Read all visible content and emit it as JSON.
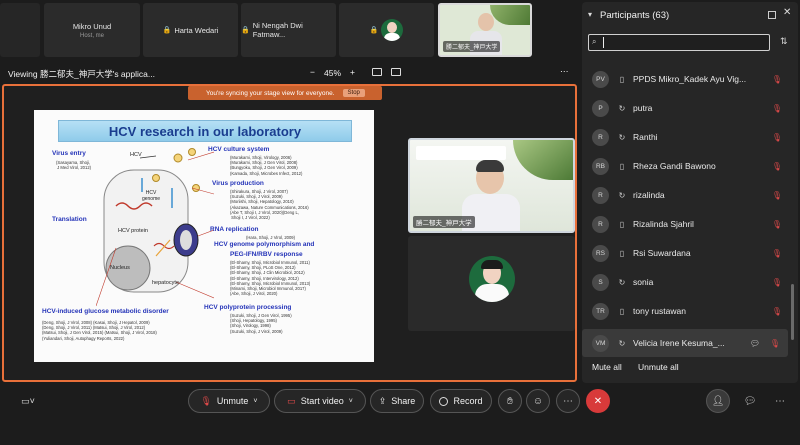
{
  "thumbnails": [
    {
      "name": "Mikro Unud",
      "sub": "Host, me"
    },
    {
      "name": "Harta Wedari"
    },
    {
      "name": "Ni Nengah Dwi Fatmaw..."
    },
    {
      "name": ""
    },
    {
      "name": "勝二郁夫_神戸大学"
    }
  ],
  "viewbar": {
    "title": "Viewing 勝二郁夫_神戸大学's applica...",
    "zoom_minus": "−",
    "zoom": "45%",
    "zoom_plus": "+",
    "more": "⋯"
  },
  "sync_banner": {
    "text": "You're syncing your stage view for everyone.",
    "stop": "Stop"
  },
  "slide": {
    "title": "HCV research in our laboratory",
    "labels": {
      "virus_entry": "Virus entry",
      "translation": "Translation",
      "hcv": "HCV",
      "hcv_genome": "HCV\ngenome",
      "hcv_protein": "HCV protein",
      "nucleus": "Nucleus",
      "hepatocyte": "hepatocyte",
      "culture": "HCV culture system",
      "production": "Virus production",
      "replication": "RNA replication",
      "polymorphism1": "HCV genome polymorphism and",
      "polymorphism2": "PEG-IFN/RBV response",
      "polyprotein": "HCV polyprotein processing",
      "glucose": "HCV-induced glucose metabolic disorder"
    },
    "refs": {
      "entry": "(Sasayama, Shoji,\n J Med Virol, 2012)",
      "culture": "(Murakami, Shoji, Virology, 2006)\n(Murakami, Shoji, J Gen Virol, 2008)\n(Bungyoku, Shoji, J Gen Virol, 2009)\n(Kamada, Shoji, Microbes Infect, 2012)",
      "production": "(Shirakura, Shoji, J Virol, 2007)\n(Suzuki, Shoji, J Virol, 2009)\n(Moriishi, Shoji, Hepatology, 2010)\n(Akazawa, Nature Communications, 2016)\n(Abe T, Shoji I, J Virol, 2020)(Deng L,\n Shoji I, J Virol, 2022)",
      "replication": "(Hara, Shoji, J Virol, 2009)",
      "polymorphism": "(El-Shamy, Shoji, Microbiol Immunol, 2011)\n(El-Shamy, Shoji, PLoS One, 2012)\n(El-Shamy, Shoji, J Clin Microbiol, 2012)\n(El-Shamy, Shoji, Intervirology, 2012)\n(El-Shamy, Shoji, Microbiol Immunol, 2013)\n(Minami, Shoji, Microbiol Immunol, 2017)\n(Abe, Shoji, J Virol, 2020)",
      "polyprotein": "(Suzuki, Shoji, J Gen Virol, 1995)\n(Shoji, Hepatology, 1995)\n(Shoji, Virology, 1998)\n(Suzuki, Shoji, J Virol, 2009)",
      "glucose": "(Deng, Shoji, J Virol, 2008) (Kasai, Shoji, J Hepatol, 2009)\n(Deng, Shoji, J Virol, 2011) (Matsui, Shoji, J Virol, 2012)\n(Matsui, Shoji, J Gen Virol, 2015) (Matsui, Shoji, J Virol, 2018)\n(Yuliandari, Shoji, Autophagy Reports, 2022)"
    }
  },
  "speaker_video": {
    "name": "勝二郁夫_神戸大学"
  },
  "participants": {
    "title": "Participants (63)",
    "search_placeholder": "",
    "items": [
      {
        "initials": "PV",
        "name": "PPDS Mikro_Kadek Ayu Vig..."
      },
      {
        "initials": "P",
        "name": "putra"
      },
      {
        "initials": "R",
        "name": "Ranthi"
      },
      {
        "initials": "RB",
        "name": "Rheza Gandi Bawono"
      },
      {
        "initials": "R",
        "name": "rizalinda"
      },
      {
        "initials": "R",
        "name": "Rizalinda Sjahril"
      },
      {
        "initials": "RS",
        "name": "Rsi Suwardana"
      },
      {
        "initials": "S",
        "name": "sonia"
      },
      {
        "initials": "TR",
        "name": "tony rustawan"
      },
      {
        "initials": "VM",
        "name": "Velicia Irene Kesuma_..."
      }
    ],
    "mute_all": "Mute all",
    "unmute_all": "Unmute all"
  },
  "controls": {
    "unmute": "Unmute",
    "start_video": "Start video",
    "share": "Share",
    "record": "Record"
  },
  "colors": {
    "accent": "#e8703a",
    "end_call": "#d83a3a",
    "mic_muted": "#e14a4a"
  }
}
